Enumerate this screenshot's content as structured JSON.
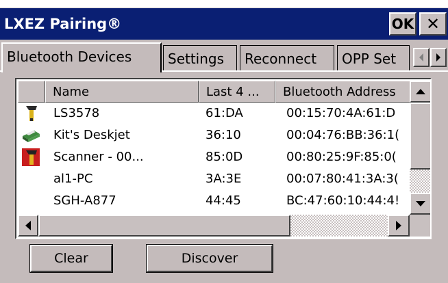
{
  "window": {
    "title": "LXEZ Pairing®",
    "ok_label": "OK",
    "close_label": "✕"
  },
  "tabs": [
    {
      "label": "Bluetooth Devices",
      "active": true
    },
    {
      "label": "Settings",
      "active": false
    },
    {
      "label": "Reconnect",
      "active": false
    },
    {
      "label": "OPP Set",
      "active": false
    }
  ],
  "table": {
    "columns": [
      "",
      "Name",
      "Last 4 ...",
      "Bluetooth Address"
    ],
    "rows": [
      {
        "icon": "barcode-scanner-icon",
        "name": "LS3578",
        "last4": "61:DA",
        "address": "00:15:70:4A:61:D"
      },
      {
        "icon": "printer-icon",
        "name": "Kit's Deskjet",
        "last4": "36:10",
        "address": "00:04:76:BB:36:1("
      },
      {
        "icon": "scanner-icon",
        "name": "Scanner - 00...",
        "last4": "85:0D",
        "address": "00:80:25:9F:85:0("
      },
      {
        "icon": "",
        "name": "al1-PC",
        "last4": "3A:3E",
        "address": "00:07:80:41:3A:3("
      },
      {
        "icon": "",
        "name": "SGH-A877",
        "last4": "44:45",
        "address": "BC:47:60:10:44:4!"
      }
    ]
  },
  "buttons": {
    "clear": "Clear",
    "discover": "Discover"
  }
}
